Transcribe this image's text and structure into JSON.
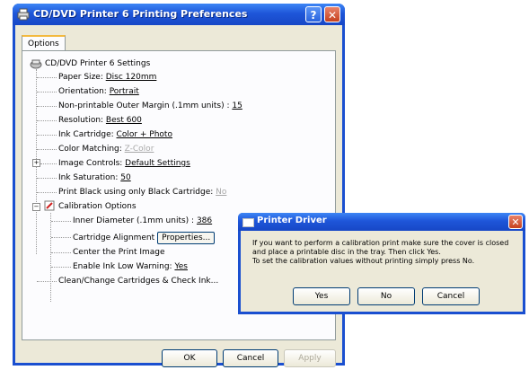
{
  "window": {
    "title": "CD/DVD Printer 6 Printing Preferences",
    "help_label": "?",
    "close_label": "✕",
    "tab": "Options"
  },
  "tree": {
    "root": "CD/DVD Printer 6 Settings",
    "items": [
      {
        "label": "Paper Size: ",
        "value": "Disc 120mm"
      },
      {
        "label": "Orientation: ",
        "value": "Portrait"
      },
      {
        "label": "Non-printable Outer Margin (.1mm units) : ",
        "value": "15"
      },
      {
        "label": "Resolution: ",
        "value": "Best 600"
      },
      {
        "label": "Ink Cartridge: ",
        "value": "Color + Photo"
      },
      {
        "label": "Color Matching: ",
        "value": "Z-Color"
      },
      {
        "label": "Image Controls: ",
        "value": "Default Settings"
      },
      {
        "label": "Ink Saturation: ",
        "value": "50"
      },
      {
        "label": "Print Black using only Black Cartridge: ",
        "value": "No"
      },
      {
        "label": "Calibration Options",
        "value": ""
      },
      {
        "label": "Inner Diameter (.1mm units) : ",
        "value": "386"
      },
      {
        "label": "Cartridge Alignment",
        "value": "",
        "button": "Properties..."
      },
      {
        "label": "Center the Print Image",
        "value": ""
      },
      {
        "label": "Enable Ink Low Warning: ",
        "value": "Yes"
      },
      {
        "label": "Clean/Change Cartridges & Check Ink...",
        "value": ""
      }
    ]
  },
  "buttons": {
    "ok": "OK",
    "cancel": "Cancel",
    "apply": "Apply"
  },
  "dialog": {
    "title": "Printer Driver",
    "close_label": "✕",
    "lines": [
      "If you want to perform a calibration print make sure the cover is closed",
      "and place a printable disc in the tray.  Then click Yes.",
      "To set the calibration values without printing simply press No."
    ],
    "yes": "Yes",
    "no": "No",
    "cancel": "Cancel"
  },
  "colors": {
    "title_bar": "#1e56d9",
    "close_button": "#c6411e",
    "dialog_face": "#ece9d8",
    "tab_highlight": "#f3b93e"
  }
}
